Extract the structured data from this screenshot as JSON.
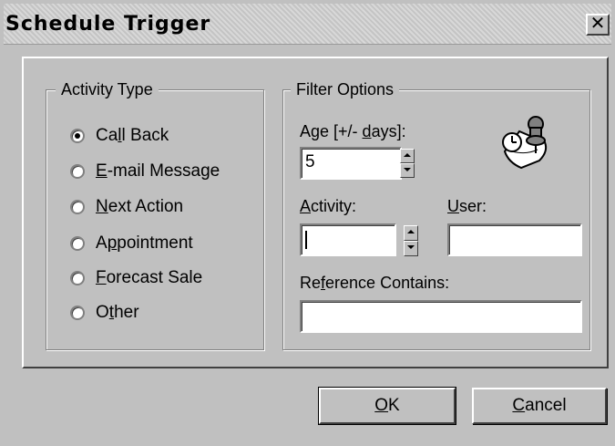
{
  "dialog": {
    "title": "Schedule Trigger",
    "close_glyph": "✕"
  },
  "activity_type": {
    "label": "Activity Type",
    "options": [
      {
        "pre": "Ca",
        "u": "l",
        "post": "l Back",
        "checked": true
      },
      {
        "pre": "",
        "u": "E",
        "post": "-mail Message",
        "checked": false
      },
      {
        "pre": "",
        "u": "N",
        "post": "ext Action",
        "checked": false
      },
      {
        "pre": "A",
        "u": "p",
        "post": "pointment",
        "checked": false
      },
      {
        "pre": "",
        "u": "F",
        "post": "orecast Sale",
        "checked": false
      },
      {
        "pre": "O",
        "u": "t",
        "post": "her",
        "checked": false
      }
    ]
  },
  "filter_options": {
    "label": "Filter Options",
    "age": {
      "pre": "Age [+/- ",
      "u": "d",
      "post": "ays]:",
      "value": "5"
    },
    "activity": {
      "pre": "",
      "u": "A",
      "post": "ctivity:",
      "value": ""
    },
    "user": {
      "pre": "",
      "u": "U",
      "post": "ser:",
      "value": ""
    },
    "reference": {
      "pre": "Re",
      "u": "f",
      "post": "erence Contains:",
      "value": ""
    },
    "icon": "schedule-pushpin-icon"
  },
  "buttons": {
    "ok": {
      "pre": "",
      "u": "O",
      "post": "K"
    },
    "cancel": {
      "pre": "",
      "u": "C",
      "post": "ancel"
    }
  }
}
